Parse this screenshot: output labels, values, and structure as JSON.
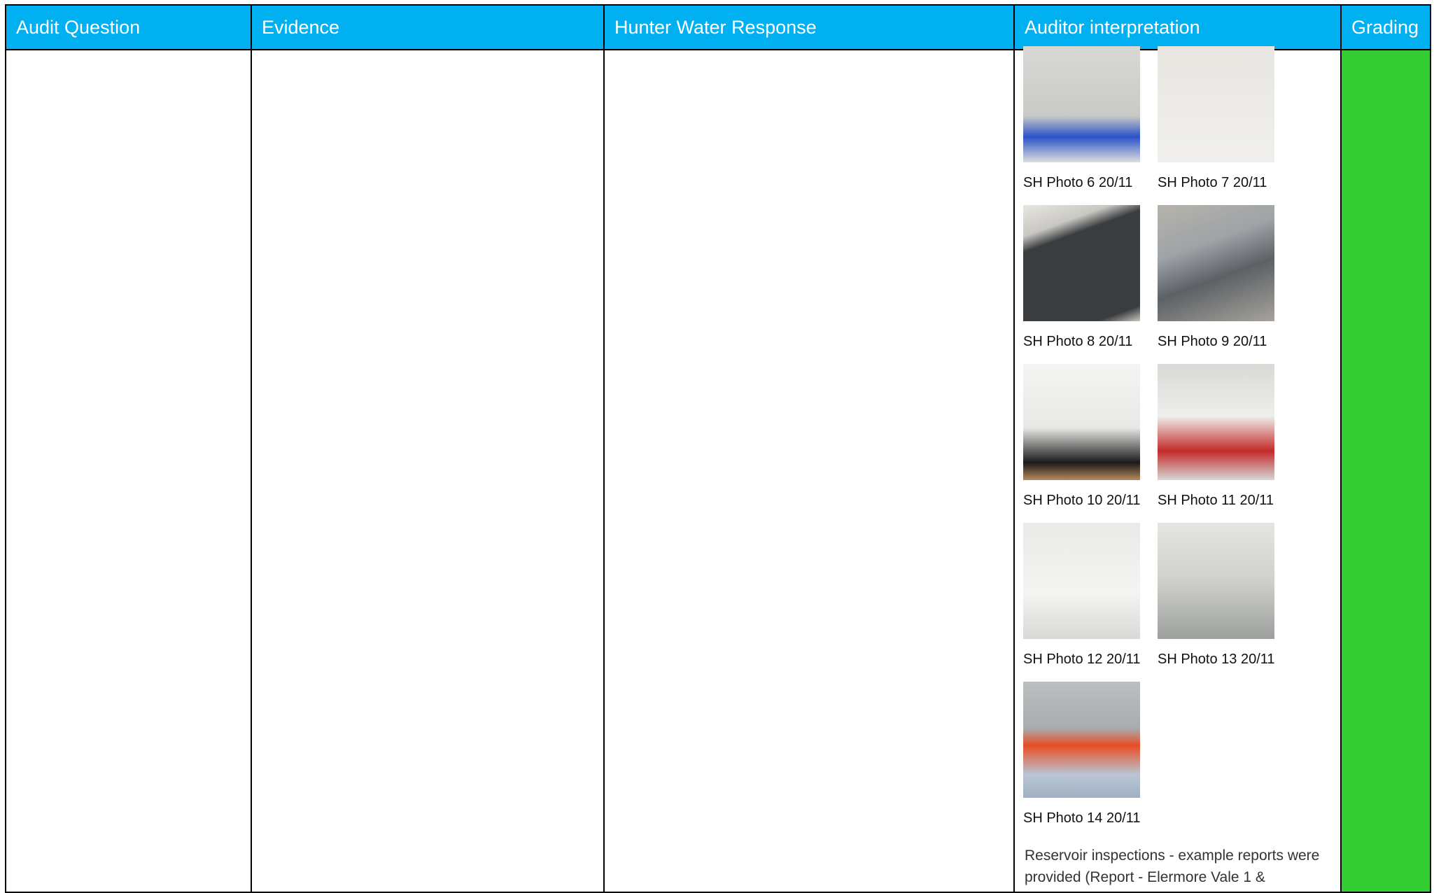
{
  "table": {
    "headers": {
      "audit_question": "Audit Question",
      "evidence": "Evidence",
      "response": "Hunter Water Response",
      "interpretation": "Auditor interpretation",
      "grading": "Grading"
    },
    "colors": {
      "header_bg": "#00b0f0",
      "grading_bg": "#33cc33"
    }
  },
  "photos": [
    {
      "caption": "SH Photo 6 20/11"
    },
    {
      "caption": "SH Photo 7 20/11"
    },
    {
      "caption": "SH Photo 8 20/11"
    },
    {
      "caption": "SH Photo 9 20/11"
    },
    {
      "caption": "SH Photo 10 20/11"
    },
    {
      "caption": "SH Photo 11 20/11"
    },
    {
      "caption": "SH Photo 12 20/11"
    },
    {
      "caption": "SH Photo 13 20/11"
    },
    {
      "caption": "SH Photo 14 20/11"
    }
  ],
  "interpretation_text": "Reservoir inspections - example reports were provided (Report - Elermore Vale 1 &"
}
